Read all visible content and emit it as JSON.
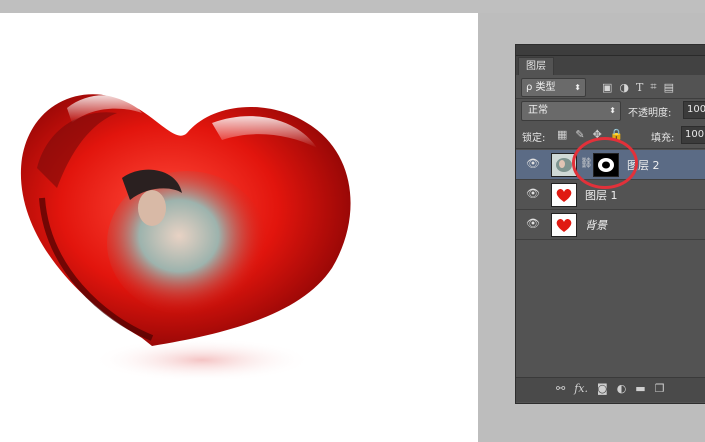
{
  "panel": {
    "tab_label": "图层",
    "filter_select": "ρ 类型",
    "filter_icons": [
      "image-filter-icon",
      "adjustment-filter-icon",
      "type-filter-icon",
      "shape-filter-icon",
      "smart-object-filter-icon"
    ],
    "blend_mode": "正常",
    "opacity_label": "不透明度:",
    "opacity_value": "100",
    "lock_label": "锁定:",
    "fill_label": "填充:",
    "fill_value": "100",
    "layers": [
      {
        "name": "图层 2",
        "selected": true,
        "italic": false,
        "has_mask": true
      },
      {
        "name": "图层 1",
        "selected": false,
        "italic": false,
        "has_mask": false
      },
      {
        "name": "背景",
        "selected": false,
        "italic": true,
        "has_mask": false
      }
    ],
    "bottom_icons": [
      "link-layers-icon",
      "fx-icon",
      "add-mask-icon",
      "adjustment-layer-icon",
      "new-group-icon",
      "new-layer-icon"
    ],
    "fx_label": "fx."
  },
  "colors": {
    "panel_bg": "#535353",
    "selected_layer": "#5b6b85",
    "annotation": "#e2313a"
  }
}
